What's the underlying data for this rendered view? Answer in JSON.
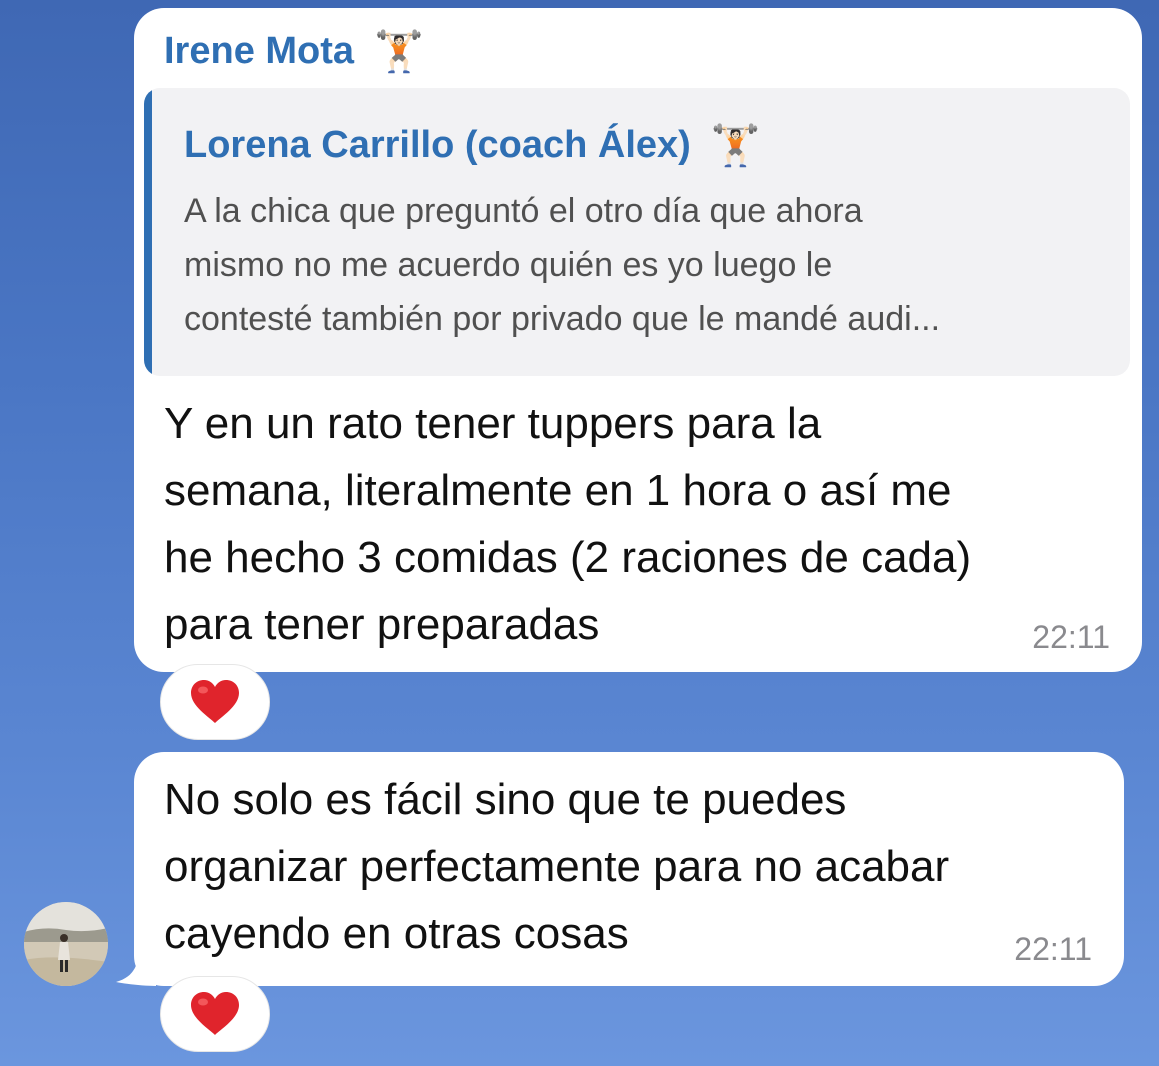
{
  "messages": [
    {
      "sender": "Irene Mota",
      "sender_emoji": "🏋🏻",
      "reply": {
        "name": "Lorena Carrillo (coach Álex)",
        "name_emoji": "🏋🏻",
        "text": "A la chica que preguntó el otro día que ahora\nmismo no me acuerdo quién es yo luego le\ncontesté también por privado que le mandé audi..."
      },
      "text": "Y en un rato tener tuppers para la\nsemana, literalmente en 1 hora o así me\nhe hecho 3 comidas (2 raciones de cada)\npara tener preparadas",
      "time": "22:11",
      "reaction": "heart"
    },
    {
      "text": "No solo es fácil sino que te puedes\norganizar perfectamente para no acabar\ncayendo en otras cosas",
      "time": "22:11",
      "reaction": "heart"
    }
  ],
  "colors": {
    "accent": "#2f6fb3",
    "heart": "#e0242c",
    "bubble": "#ffffff",
    "background_top": "#3f68b4",
    "background_bottom": "#6b96de"
  }
}
